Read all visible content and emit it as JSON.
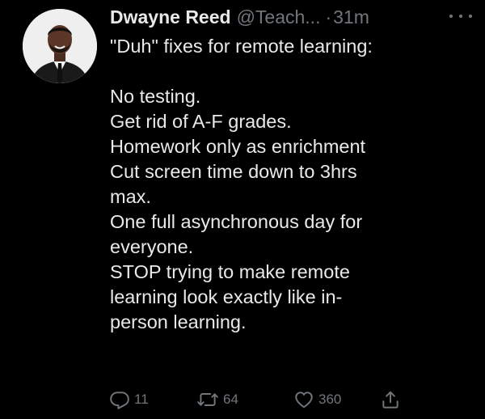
{
  "tweet": {
    "author_name": "Dwayne Reed",
    "author_handle": "@Teach...",
    "separator": "·",
    "timestamp": "31m",
    "text_lines": [
      "\"Duh\" fixes for remote learning:",
      "",
      "No testing.",
      "Get rid of A-F grades.",
      "Homework only as enrichment",
      "Cut screen time down to 3hrs",
      "max.",
      "One full asynchronous day for",
      "everyone.",
      "STOP trying to make remote",
      "learning look exactly like in-",
      "person learning."
    ]
  },
  "actions": {
    "reply_count": "11",
    "retweet_count": "64",
    "like_count": "360"
  },
  "icons": {
    "reply": "reply-icon",
    "retweet": "retweet-icon",
    "like": "heart-icon",
    "share": "share-icon",
    "more": "more-icon"
  },
  "colors": {
    "background": "#000000",
    "primary_text": "#e7e9ea",
    "secondary_text": "#71767b"
  }
}
